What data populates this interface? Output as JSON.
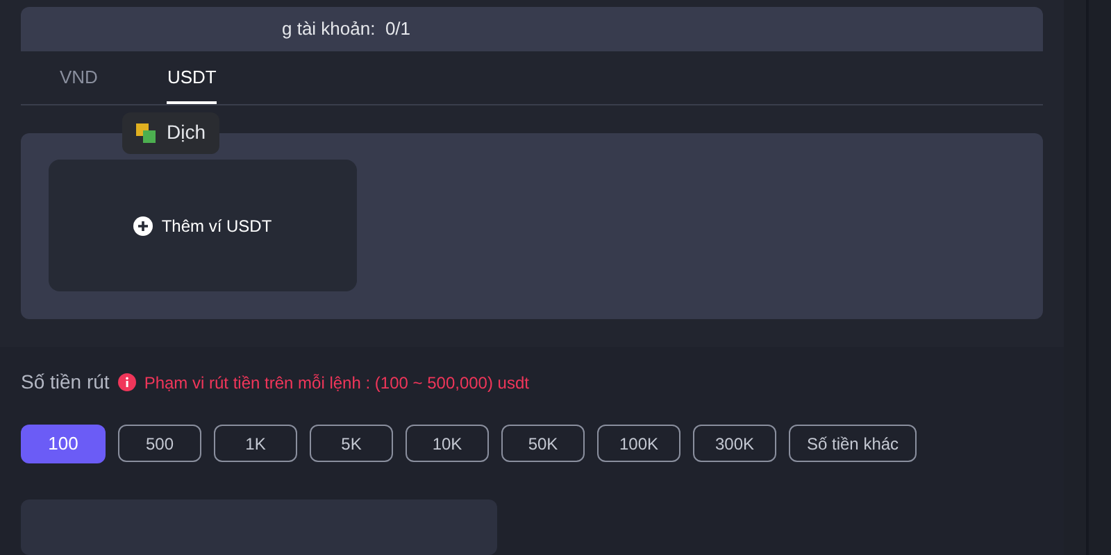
{
  "header": {
    "text": "g tài khoản:  0/1"
  },
  "tabs": [
    {
      "label": "VND",
      "selected": false
    },
    {
      "label": "USDT",
      "selected": true
    }
  ],
  "translate_popup": {
    "label": "Dịch"
  },
  "wallet": {
    "add_label": "Thêm ví USDT"
  },
  "amount": {
    "label": "Số tiền rút",
    "hint": "Phạm vi rút tiền trên mỗi lệnh : (100 ~ 500,000) usdt"
  },
  "chips": [
    {
      "label": "100",
      "selected": true
    },
    {
      "label": "500",
      "selected": false
    },
    {
      "label": "1K",
      "selected": false
    },
    {
      "label": "5K",
      "selected": false
    },
    {
      "label": "10K",
      "selected": false
    },
    {
      "label": "50K",
      "selected": false
    },
    {
      "label": "100K",
      "selected": false
    },
    {
      "label": "300K",
      "selected": false
    },
    {
      "label": "Số tiền khác",
      "selected": false
    }
  ]
}
